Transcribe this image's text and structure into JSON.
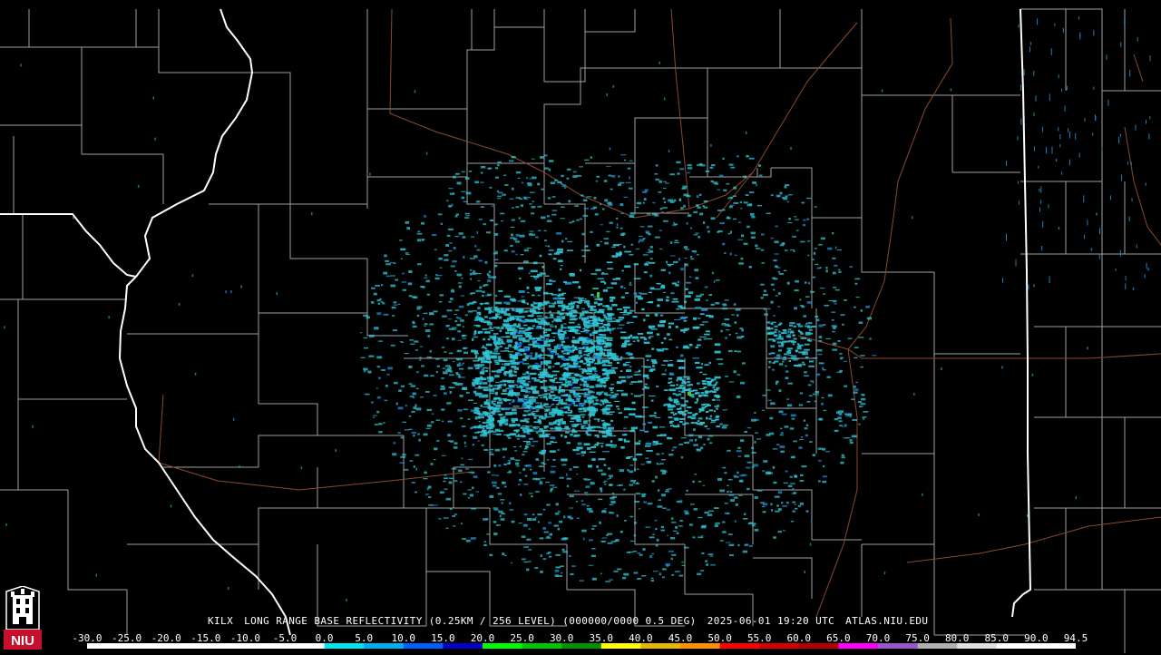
{
  "product": {
    "station": "KILX",
    "description": "LONG RANGE BASE REFLECTIVITY (0.25KM / 256 LEVEL) (000000/0000 0.5 DEG)",
    "datetime": "2025-06-01 19:20 UTC",
    "source": "ATLAS.NIU.EDU"
  },
  "logo": {
    "text": "NIU",
    "icon": "niu-altgeld-tower-logo",
    "color": "#c8102e"
  },
  "colorbar": {
    "labels": [
      "-30.0",
      "-25.0",
      "-20.0",
      "-15.0",
      "-10.0",
      "-5.0",
      "0.0",
      "5.0",
      "10.0",
      "15.0",
      "20.0",
      "25.0",
      "30.0",
      "35.0",
      "40.0",
      "45.0",
      "50.0",
      "55.0",
      "60.0",
      "65.0",
      "70.0",
      "75.0",
      "80.0",
      "85.0",
      "90.0",
      "94.5"
    ],
    "colors": [
      "#ffffff",
      "#ffffff",
      "#ffffff",
      "#ffffff",
      "#ffffff",
      "#ffffff",
      "#00e5ee",
      "#00b0f0",
      "#0060ff",
      "#0000c8",
      "#00ff00",
      "#00c800",
      "#009000",
      "#ffff00",
      "#e6b800",
      "#ff9000",
      "#ff0000",
      "#d40000",
      "#b00000",
      "#ff00ff",
      "#9955c9",
      "#b0b0b0",
      "#e0e0e0",
      "#ffffff",
      "#ffffff"
    ]
  },
  "map_colors": {
    "state_border": "#ffffff",
    "county_border": "#a0a0a0",
    "highway": "#8b4a2e",
    "echo_primary": "#2fc6d6",
    "echo_secondary": "#1e8fd0",
    "echo_strong": "#1a5ad8",
    "echo_peak": "#3cd22a"
  }
}
